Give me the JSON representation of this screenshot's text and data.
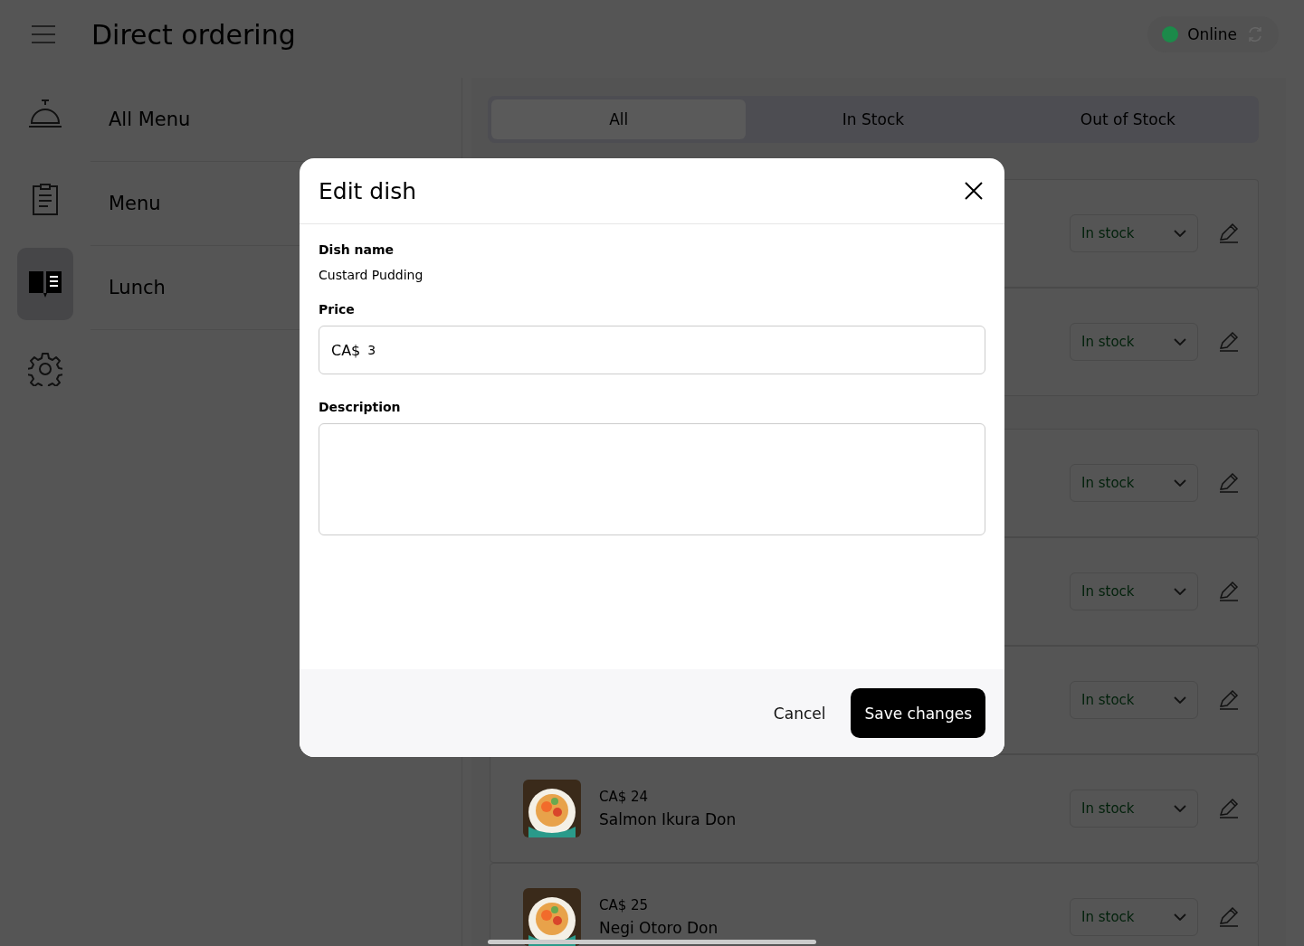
{
  "header": {
    "title": "Direct ordering",
    "status": {
      "label": "Online",
      "online": true
    }
  },
  "rail": [
    {
      "kind": "bell",
      "selected": false
    },
    {
      "kind": "clipboard",
      "selected": false
    },
    {
      "kind": "book",
      "selected": true
    },
    {
      "kind": "gear",
      "selected": false
    }
  ],
  "categories": [
    {
      "label": "All Menu"
    },
    {
      "label": "Menu"
    },
    {
      "label": "Lunch"
    }
  ],
  "tabs": [
    {
      "label": "All",
      "selected": true
    },
    {
      "label": "In Stock",
      "selected": false
    },
    {
      "label": "Out of Stock",
      "selected": false
    }
  ],
  "sections": [
    {
      "dishes": [
        {
          "stock": "In stock"
        },
        {
          "stock": "In stock"
        }
      ]
    },
    {
      "dishes": [
        {
          "stock": "In stock"
        },
        {
          "stock": "In stock"
        },
        {
          "stock": "In stock"
        },
        {
          "price": "CA$ 24",
          "name": "Salmon Ikura Don",
          "stock": "In stock"
        },
        {
          "price": "CA$ 25",
          "name": "Negi Otoro Don",
          "stock": "In stock"
        }
      ]
    }
  ],
  "dialog": {
    "title": "Edit dish",
    "dish_name_label": "Dish name",
    "dish_name": "Custard Pudding",
    "price_label": "Price",
    "currency": "CA$",
    "price": "3",
    "description_label": "Description",
    "cancel": "Cancel",
    "save": "Save changes"
  }
}
